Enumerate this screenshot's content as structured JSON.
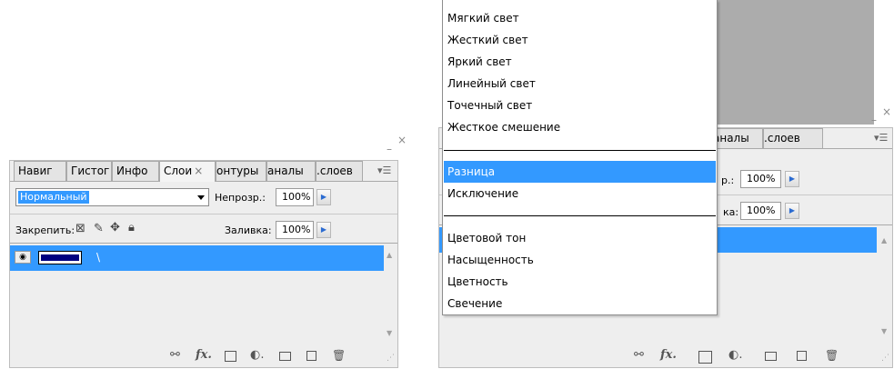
{
  "left_panel": {
    "window_controls": {
      "minimize": "–",
      "close": "×"
    },
    "tabs": [
      {
        "label": "Навиг",
        "active": false
      },
      {
        "label": "Гистог",
        "active": false
      },
      {
        "label": "Инфо",
        "active": false
      },
      {
        "label": "Слои",
        "active": true,
        "close": "×"
      },
      {
        "label": "онтуры",
        "active": false
      },
      {
        "label": "аналы",
        "active": false
      },
      {
        "label": ".слоев",
        "active": false
      }
    ],
    "menu_icon": "▾☰",
    "blend_mode_value": "Нормальный",
    "opacity_label": "Непрозр.:",
    "opacity_value": "100%",
    "lock_label": "Закрепить:",
    "fill_label": "Заливка:",
    "fill_value": "100%",
    "layer_name": "\\",
    "footer_icons": [
      "link-icon",
      "fx-icon",
      "mask-icon",
      "adjustment-icon",
      "folder-icon",
      "new-layer-icon",
      "trash-icon"
    ]
  },
  "right_panel": {
    "window_controls": {
      "minimize": "–",
      "close": "×"
    },
    "tabs": [
      {
        "label": "аналы",
        "active": false
      },
      {
        "label": ".слоев",
        "active": false
      }
    ],
    "menu_icon": "▾☰",
    "opacity_label_partial": "р.:",
    "opacity_value": "100%",
    "fill_label_partial": "ка:",
    "fill_value": "100%"
  },
  "blend_dropdown": {
    "items": [
      {
        "label": "Мягкий свет"
      },
      {
        "label": "Жесткий свет"
      },
      {
        "label": "Яркий свет"
      },
      {
        "label": "Линейный свет"
      },
      {
        "label": "Точечный свет"
      },
      {
        "label": "Жесткое смешение"
      },
      {
        "separator": true
      },
      {
        "label": "Разница",
        "selected": true
      },
      {
        "label": "Исключение"
      },
      {
        "separator": true
      },
      {
        "label": "Цветовой тон"
      },
      {
        "label": "Насыщенность"
      },
      {
        "label": "Цветность"
      },
      {
        "label": "Свечение"
      }
    ]
  },
  "colors": {
    "selection": "#3399ff",
    "panel_bg": "#eeeeee",
    "gray_area": "#acacac"
  }
}
